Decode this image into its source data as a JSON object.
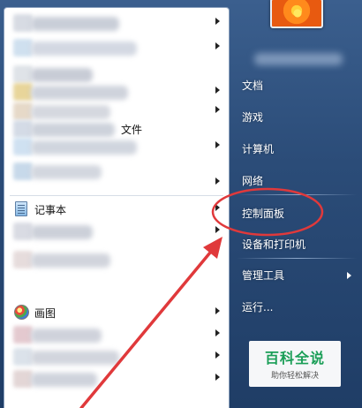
{
  "left_menu": {
    "items": [
      {
        "label": "",
        "has_submenu": true
      },
      {
        "label": "",
        "has_submenu": true
      },
      {
        "label": "",
        "has_submenu": false
      },
      {
        "label": "",
        "has_submenu": true
      },
      {
        "label": "",
        "has_submenu": true
      },
      {
        "label": "文件",
        "has_submenu": false
      },
      {
        "label": "",
        "has_submenu": true
      },
      {
        "label": "",
        "has_submenu": false
      },
      {
        "label": "记事本",
        "has_submenu": true
      },
      {
        "label": "",
        "has_submenu": true
      },
      {
        "label": "",
        "has_submenu": false
      },
      {
        "label": "画图",
        "has_submenu": true
      },
      {
        "label": "",
        "has_submenu": true
      },
      {
        "label": "",
        "has_submenu": true
      },
      {
        "label": "",
        "has_submenu": true
      }
    ]
  },
  "right_menu": {
    "documents": "文档",
    "games": "游戏",
    "computer": "计算机",
    "network": "网络",
    "control_panel": "控制面板",
    "devices_printers": "设备和打印机",
    "admin_tools": "管理工具",
    "run": "运行..."
  },
  "annotation": {
    "color": "#e0393b",
    "target": "control_panel"
  },
  "watermark": {
    "title": "百科全说",
    "subtitle": "助你轻松解决"
  },
  "colors": {
    "menu_background": "#2b4c78",
    "left_pane": "#ffffff",
    "watermark_green": "#1a9e57"
  }
}
